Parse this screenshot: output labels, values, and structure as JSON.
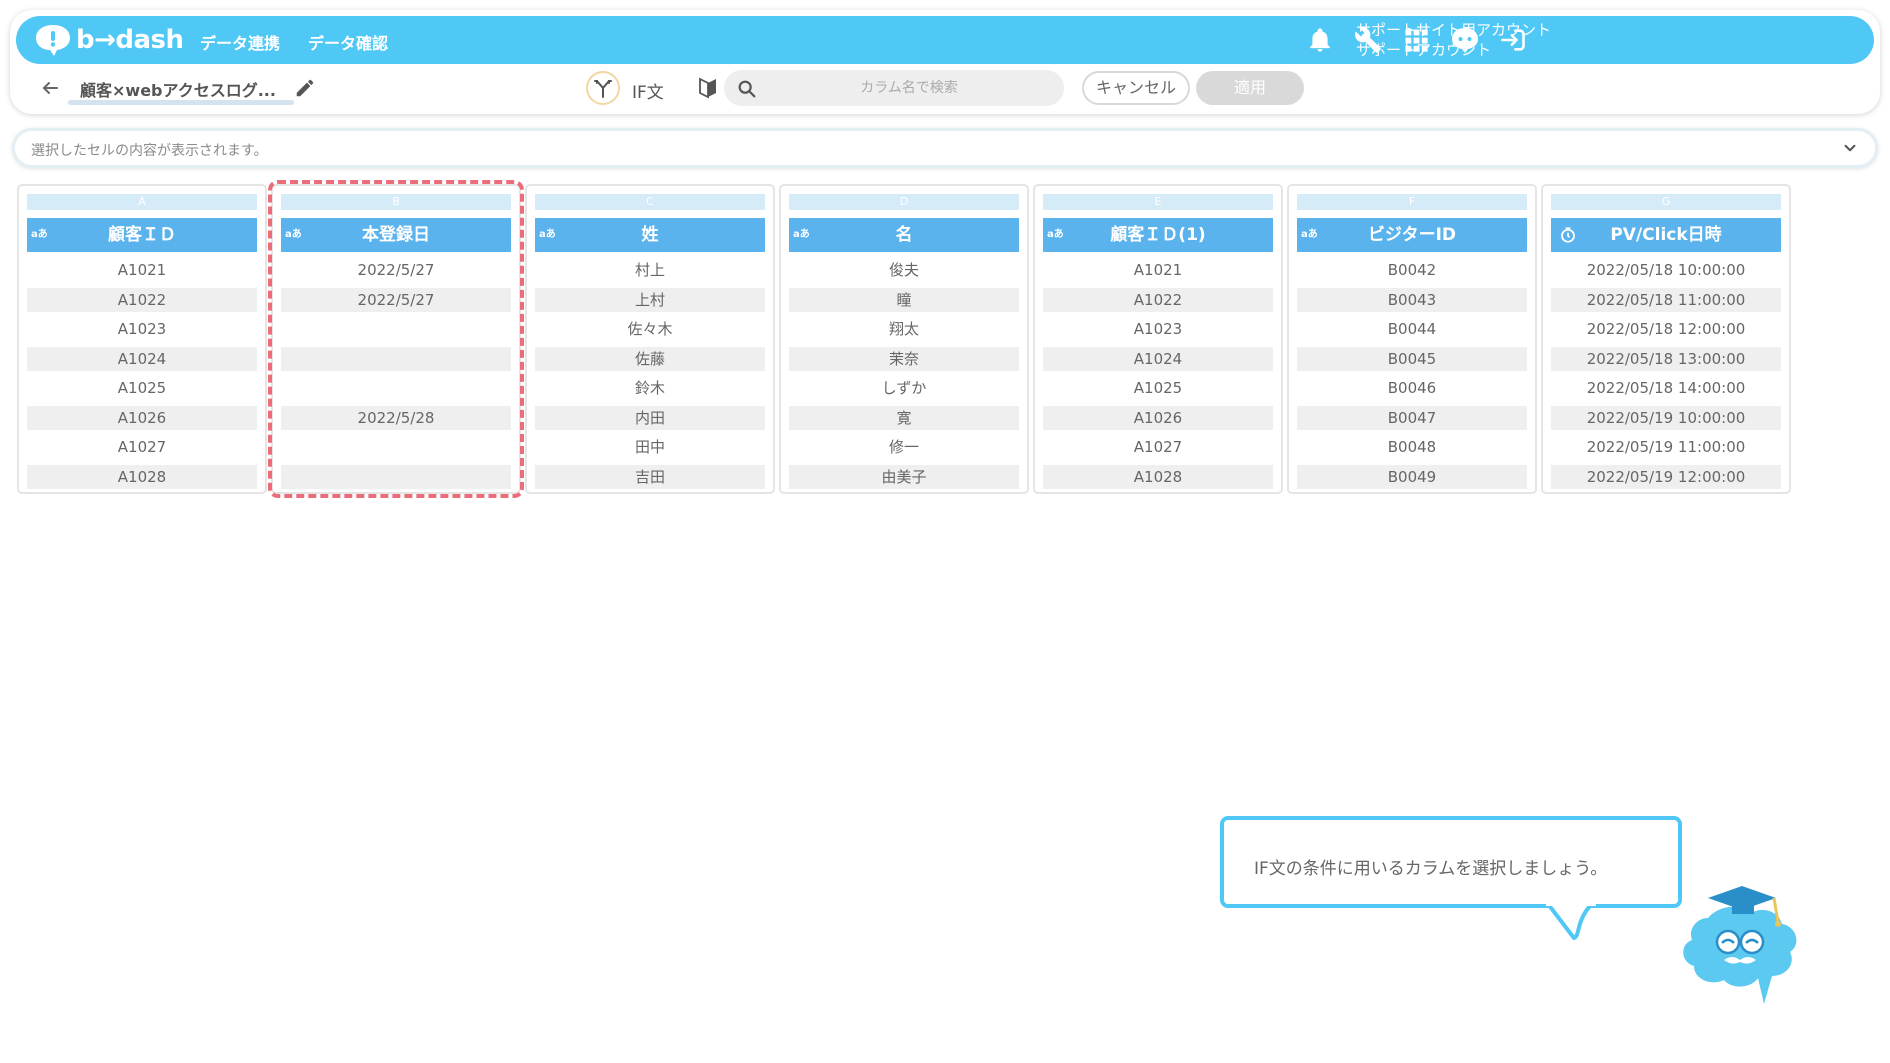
{
  "header": {
    "logo_text": "b→dash",
    "nav": [
      "データ連携",
      "データ確認"
    ],
    "account_line1": "サポートサイト用アカウント",
    "account_line2": "サポートアカウント",
    "icons": [
      "bell-icon",
      "wrench-icon",
      "grid-icon",
      "chat-icon",
      "logout-icon"
    ]
  },
  "toolbar": {
    "sheet_title": "顧客×webアクセスログ...",
    "if_label": "IF文",
    "search_placeholder": "カラム名で検索",
    "cancel_label": "キャンセル",
    "apply_label": "適用"
  },
  "cellbar": {
    "text": "選択したセルの内容が表示されます。"
  },
  "table": {
    "columns": [
      {
        "letter": "A",
        "title": "顧客ＩＤ",
        "type": "text",
        "cells": [
          "A1021",
          "A1022",
          "A1023",
          "A1024",
          "A1025",
          "A1026",
          "A1027",
          "A1028"
        ]
      },
      {
        "letter": "B",
        "title": "本登録日",
        "type": "text",
        "cells": [
          "2022/5/27",
          "2022/5/27",
          "",
          "",
          "",
          "2022/5/28",
          "",
          ""
        ]
      },
      {
        "letter": "C",
        "title": "姓",
        "type": "text",
        "cells": [
          "村上",
          "上村",
          "佐々木",
          "佐藤",
          "鈴木",
          "内田",
          "田中",
          "吉田"
        ]
      },
      {
        "letter": "D",
        "title": "名",
        "type": "text",
        "cells": [
          "俊夫",
          "瞳",
          "翔太",
          "茉奈",
          "しずか",
          "寛",
          "修一",
          "由美子"
        ]
      },
      {
        "letter": "E",
        "title": "顧客ＩＤ(1)",
        "type": "text",
        "cells": [
          "A1021",
          "A1022",
          "A1023",
          "A1024",
          "A1025",
          "A1026",
          "A1027",
          "A1028"
        ]
      },
      {
        "letter": "F",
        "title": "ビジターID",
        "type": "text",
        "cells": [
          "B0042",
          "B0043",
          "B0044",
          "B0045",
          "B0046",
          "B0047",
          "B0048",
          "B0049"
        ]
      },
      {
        "letter": "G",
        "title": "PV/Click日時",
        "type": "datetime",
        "cells": [
          "2022/05/18 10:00:00",
          "2022/05/18 11:00:00",
          "2022/05/18 12:00:00",
          "2022/05/18 13:00:00",
          "2022/05/18 14:00:00",
          "2022/05/19 10:00:00",
          "2022/05/19 11:00:00",
          "2022/05/19 12:00:00"
        ]
      }
    ],
    "text_type_glyph": "aあ"
  },
  "guide": {
    "bubble_text": "IF文の条件に用いるカラムを選択しましょう。"
  },
  "colors": {
    "brand": "#4fc8f5",
    "column_header": "#5bb3ee",
    "highlight": "#ec6d7a"
  }
}
